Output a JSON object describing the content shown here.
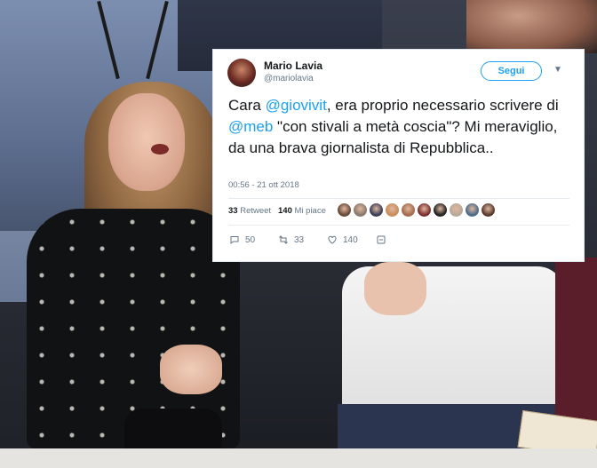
{
  "tweet": {
    "display_name": "Mario Lavia",
    "handle": "@mariolavia",
    "follow_label": "Segui",
    "text_parts": {
      "p1": "Cara ",
      "mention1": "@giovivit",
      "p2": ", era proprio necessario scrivere di ",
      "mention2": "@meb",
      "p3": " \"con stivali a metà coscia\"? Mi meraviglio, da una brava giornalista di Repubblica.."
    },
    "timestamp": "00:56 - 21 ott 2018",
    "retweets_count": "33",
    "retweets_label": "Retweet",
    "likes_count": "140",
    "likes_label": "Mi piace",
    "reply_count": "50",
    "retweet_action_count": "33",
    "like_action_count": "140"
  },
  "colors": {
    "accent": "#1da1f2",
    "text": "#14171a",
    "muted": "#657786"
  },
  "icons": [
    "chevron-down-icon",
    "reply-icon",
    "retweet-icon",
    "heart-icon",
    "direct-message-icon"
  ],
  "likers": [
    "#6b4a3a",
    "#8a7a6e",
    "#3b3f55",
    "#c98c5a",
    "#a56b4e",
    "#7a2f2f",
    "#222222",
    "#b7a89a",
    "#4d6b8a",
    "#5a3a2f"
  ]
}
